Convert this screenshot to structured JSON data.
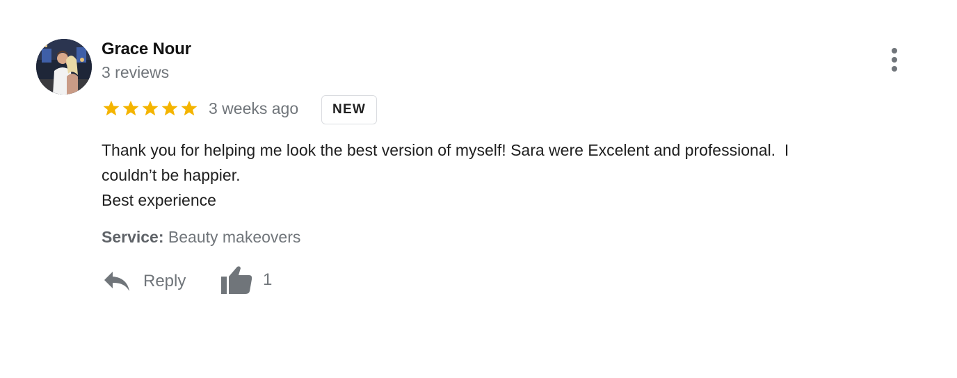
{
  "review": {
    "author": {
      "name": "Grace Nour",
      "review_count": "3 reviews",
      "avatar_icon": "profile-photo"
    },
    "rating": {
      "stars": 5,
      "max_stars": 5,
      "star_color": "#f4b400"
    },
    "time_ago": "3 weeks ago",
    "badge": "NEW",
    "text_lines": [
      "Thank you for helping me look the best version of myself! Sara were Excelent and professional.  I",
      "couldn’t be happier.",
      "Best experience"
    ],
    "service": {
      "label": "Service:",
      "value": "Beauty makeovers"
    },
    "actions": {
      "reply_label": "Reply",
      "reply_icon": "reply-arrow-icon",
      "like_icon": "thumbs-up-icon",
      "like_count": "1"
    },
    "menu_icon": "more-vertical-icon"
  },
  "colors": {
    "text_primary": "#1f1f1f",
    "text_secondary": "#70757a",
    "badge_border": "#dadce0",
    "icon_gray": "#70757a"
  }
}
